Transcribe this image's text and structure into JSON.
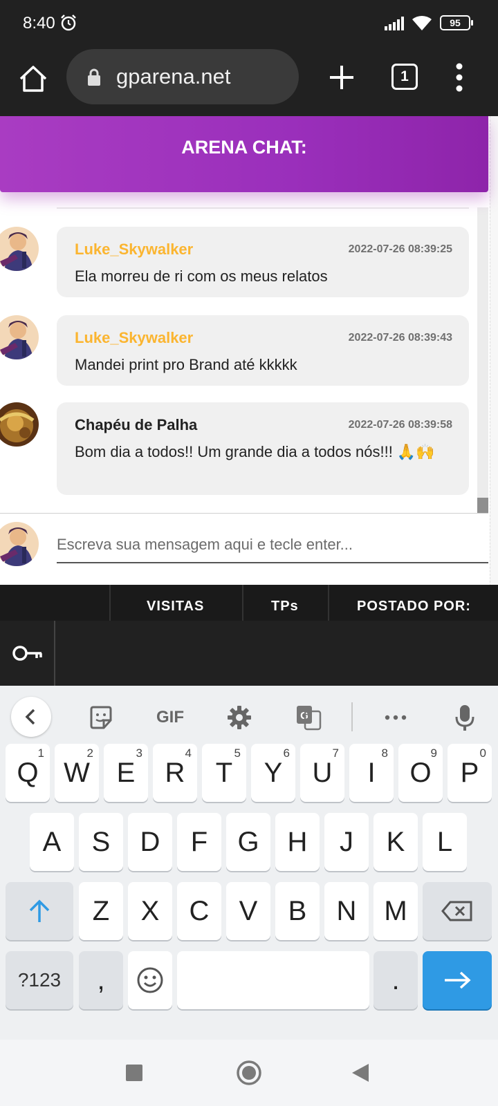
{
  "status_bar": {
    "time": "8:40",
    "battery": "95"
  },
  "browser": {
    "url": "gparena.net",
    "tab_count": "1"
  },
  "chat": {
    "title": "ARENA CHAT:",
    "messages": [
      {
        "author": "Luke_Skywalker",
        "time": "2022-07-26 08:39:25",
        "text": "Ela morreu de ri com os meus relatos"
      },
      {
        "author": "Luke_Skywalker",
        "time": "2022-07-26 08:39:43",
        "text": "Mandei print pro Brand até kkkkk"
      },
      {
        "author": "Chapéu de Palha",
        "time": "2022-07-26 08:39:58",
        "text": "Bom dia a todos!! Um grande dia a todos nós!!! 🙏🙌"
      }
    ],
    "input_placeholder": "Escreva sua mensagem aqui e tecle enter..."
  },
  "footer": {
    "columns": [
      "VISITAS",
      "TPs",
      "POSTADO POR:"
    ]
  },
  "keyboard": {
    "toolbar": {
      "gif_label": "GIF"
    },
    "row1": [
      {
        "label": "Q",
        "hint": "1"
      },
      {
        "label": "W",
        "hint": "2"
      },
      {
        "label": "E",
        "hint": "3"
      },
      {
        "label": "R",
        "hint": "4"
      },
      {
        "label": "T",
        "hint": "5"
      },
      {
        "label": "Y",
        "hint": "6"
      },
      {
        "label": "U",
        "hint": "7"
      },
      {
        "label": "I",
        "hint": "8"
      },
      {
        "label": "O",
        "hint": "9"
      },
      {
        "label": "P",
        "hint": "0"
      }
    ],
    "row2": [
      "A",
      "S",
      "D",
      "F",
      "G",
      "H",
      "J",
      "K",
      "L"
    ],
    "row3": [
      "Z",
      "X",
      "C",
      "V",
      "B",
      "N",
      "M"
    ],
    "symbols_label": "?123",
    "comma": ",",
    "period": "."
  }
}
